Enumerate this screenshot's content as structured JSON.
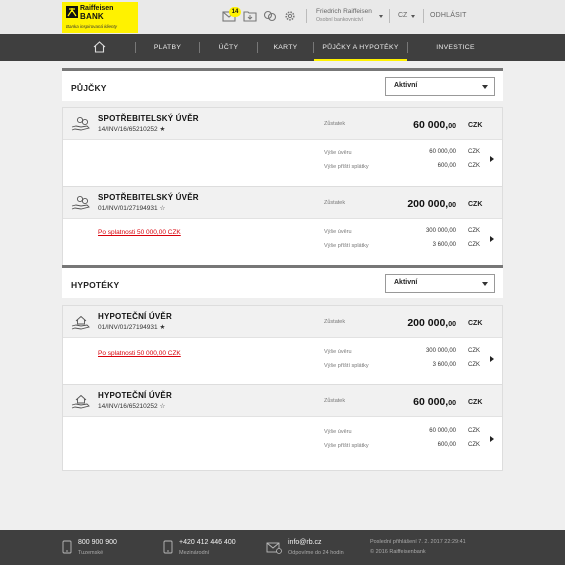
{
  "header": {
    "logo": {
      "brand_line1": "Raiffeisen",
      "brand_line2": "BANK",
      "tagline": "Banka inspirovaná klienty"
    },
    "messages_badge": "14",
    "user_name": "Friedrich Raiffeisen",
    "user_role": "Osobní bankovnictví",
    "language": "CZ",
    "logout": "ODHLÁSIT"
  },
  "nav": {
    "items": [
      {
        "label": "PLATBY"
      },
      {
        "label": "ÚČTY"
      },
      {
        "label": "KARTY"
      },
      {
        "label": "PŮJČKY A HYPOTÉKY",
        "active": true
      },
      {
        "label": "INVESTICE"
      }
    ]
  },
  "loans": {
    "title": "PŮJČKY",
    "filter_value": "Aktivní",
    "cards": [
      {
        "title": "SPOTŘEBITELSKÝ ÚVĚR",
        "number": "14/INV/16/65210252 ★",
        "balance_label": "Zůstatek",
        "balance_int": "60 000,",
        "balance_dec": "00",
        "currency": "CZK",
        "maturity": "",
        "loan_amount_label": "Výše úvěru",
        "loan_amount": "60 000,00",
        "loan_amount_cur": "CZK",
        "next_payment_label": "Výše příští splátky",
        "next_payment": "600,00",
        "next_payment_cur": "CZK"
      },
      {
        "title": "SPOTŘEBITELSKÝ ÚVĚR",
        "number": "01/INV/01/27194931 ☆",
        "balance_label": "Zůstatek",
        "balance_int": "200 000,",
        "balance_dec": "00",
        "currency": "CZK",
        "maturity": "Po splatnosti  50 000,00 CZK",
        "loan_amount_label": "Výše úvěru",
        "loan_amount": "300 000,00",
        "loan_amount_cur": "CZK",
        "next_payment_label": "Výše příští splátky",
        "next_payment": "3 600,00",
        "next_payment_cur": "CZK"
      }
    ]
  },
  "mortgages": {
    "title": "HYPOTÉKY",
    "filter_value": "Aktivní",
    "cards": [
      {
        "title": "HYPOTEČNÍ ÚVĚR",
        "number": "01/INV/01/27194931 ★",
        "balance_label": "Zůstatek",
        "balance_int": "200 000,",
        "balance_dec": "00",
        "currency": "CZK",
        "maturity": "Po splatnosti  50 000,00 CZK",
        "loan_amount_label": "Výše úvěru",
        "loan_amount": "300 000,00",
        "loan_amount_cur": "CZK",
        "next_payment_label": "Výše příští splátky",
        "next_payment": "3 600,00",
        "next_payment_cur": "CZK"
      },
      {
        "title": "HYPOTEČNÍ ÚVĚR",
        "number": "14/INV/16/65210252 ☆",
        "balance_label": "Zůstatek",
        "balance_int": "60 000,",
        "balance_dec": "00",
        "currency": "CZK",
        "maturity": "",
        "loan_amount_label": "Výše úvěru",
        "loan_amount": "60 000,00",
        "loan_amount_cur": "CZK",
        "next_payment_label": "Výše příští splátky",
        "next_payment": "600,00",
        "next_payment_cur": "CZK"
      }
    ]
  },
  "footer": {
    "phone_local": "800 900 900",
    "phone_local_sub": "Tuzemské",
    "phone_intl": "+420 412 446 400",
    "phone_intl_sub": "Mezinárodní",
    "email": "info@rb.cz",
    "email_sub": "Odpovíme do 24 hodin",
    "last_login": "Poslední přihlášení  7. 2. 2017  22:29:41",
    "copyright": "© 2016 Raiffeisenbank"
  },
  "colors": {
    "brand_yellow": "#fff200",
    "dark_bar": "#3f3f3f",
    "overdue_red": "#d8000a"
  }
}
